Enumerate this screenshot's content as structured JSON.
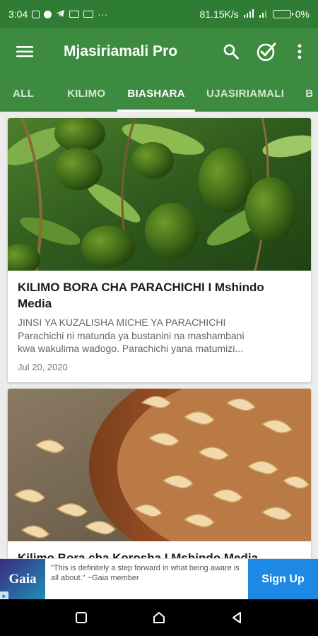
{
  "status_bar": {
    "time": "3:04",
    "more": "···",
    "network_speed": "81.15K/s",
    "battery_percent": "0%"
  },
  "app_bar": {
    "title": "Mjasiriamali Pro",
    "icons": [
      "menu-icon",
      "search-icon",
      "check-circle-icon",
      "more-vert-icon"
    ]
  },
  "tabs": [
    {
      "label": "ALL",
      "active": false
    },
    {
      "label": "KILIMO",
      "active": false
    },
    {
      "label": "BIASHARA",
      "active": true
    },
    {
      "label": "UJASIRIAMALI",
      "active": false
    },
    {
      "label": "B",
      "active": false
    }
  ],
  "posts": [
    {
      "image": "avocado-tree-photo",
      "title": "KILIMO BORA CHA PARACHICHI I Mshindo Media",
      "excerpt_lines": [
        "JINSI YA KUZALISHA MICHE YA PARACHICHI",
        "Parachichi ni matunda ya bustanini na mashambani",
        "kwa wakulima wadogo. Parachichi yana matumizi..."
      ],
      "date": "Jul 20, 2020"
    },
    {
      "image": "cashew-nuts-photo",
      "title": "Kilimo Bora cha Korosha I Mshindo Media"
    }
  ],
  "ad": {
    "brand": "Gaia",
    "text": "\"This is definitely a step forward in what being aware is all about.\" ~Gaia member",
    "cta": "Sign Up",
    "colors": {
      "cta": "#1e88e5",
      "logo_start": "#3a2b82",
      "logo_end": "#1f8fb6"
    }
  },
  "colors": {
    "status_bar": "#2f7d34",
    "app_bar": "#3d8b40",
    "background": "#ececec"
  }
}
